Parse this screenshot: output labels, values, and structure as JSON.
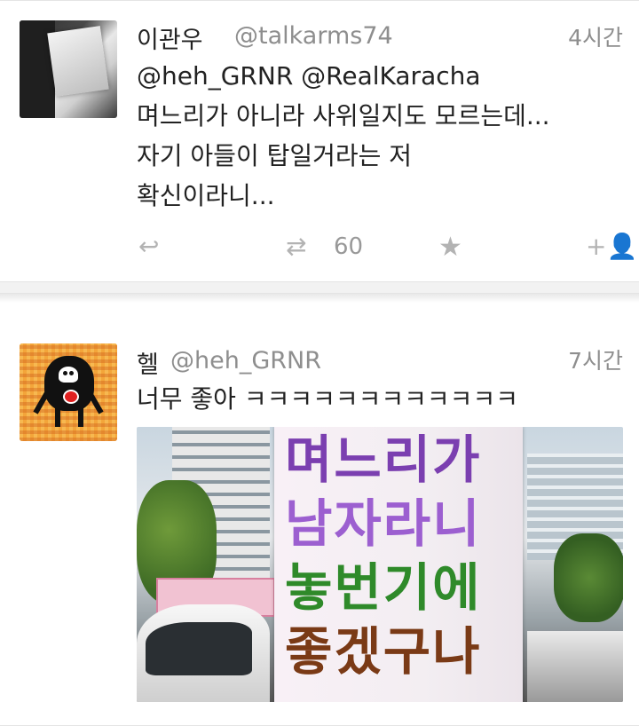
{
  "tweets": [
    {
      "name": "이관우",
      "handle": "@talkarms74",
      "time": "4시간",
      "text": "@heh_GRNR @RealKaracha\n며느리가 아니라 사위일지도 모르는데...\n자기 아들이 탑일거라는 저\n확신이라니...",
      "retweet_count": "60",
      "icons": {
        "reply": "reply-icon",
        "retweet": "retweet-icon",
        "favorite": "star-icon",
        "follow": "follow-icon"
      }
    },
    {
      "name": "헬",
      "handle": "@heh_GRNR",
      "time": "7시간",
      "text": "너무 좋아 ㅋㅋㅋㅋㅋㅋㅋㅋㅋㅋㅋㅋ",
      "photo_sign_lines": [
        "며느리가",
        "남자라니",
        "놓번기에",
        "좋겠구나"
      ]
    }
  ],
  "colors": {
    "secondary_text": "#8e8e8e",
    "action_icon": "#b3b3b3"
  }
}
